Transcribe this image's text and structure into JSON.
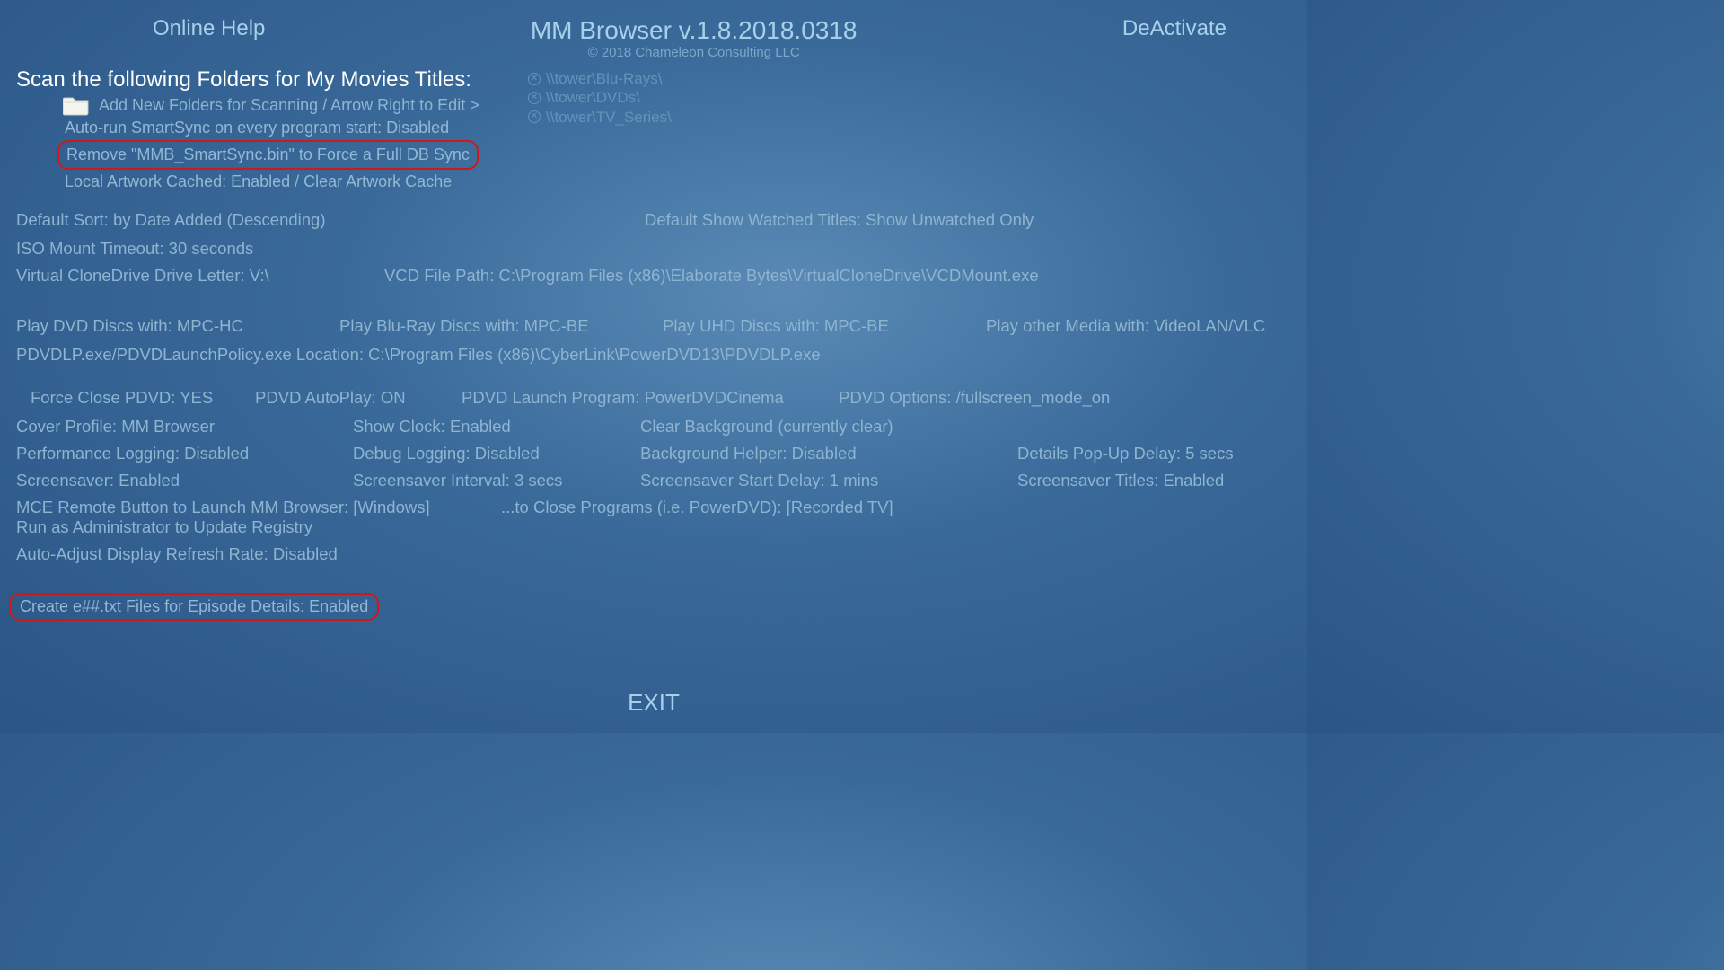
{
  "header": {
    "help": "Online Help",
    "title": "MM Browser v.1.8.2018.0318",
    "copyright": "© 2018 Chameleon Consulting LLC",
    "deactivate": "DeActivate"
  },
  "scan": {
    "heading": "Scan the following Folders for My Movies Titles:",
    "addFolders": "Add New Folders for Scanning / Arrow Right to Edit >",
    "paths": [
      "\\\\tower\\Blu-Rays\\",
      "\\\\tower\\DVDs\\",
      "\\\\tower\\TV_Series\\"
    ],
    "autorun": "Auto-run SmartSync on every program start:  Disabled",
    "remove": "Remove \"MMB_SmartSync.bin\" to Force a Full DB Sync",
    "artwork": "Local Artwork Cached: Enabled   / Clear Artwork Cache"
  },
  "settings": {
    "defaultSort": "Default Sort: by Date Added (Descending)",
    "defaultShow": "Default Show Watched Titles: Show Unwatched Only",
    "isoTimeout": "ISO Mount Timeout: 30 seconds",
    "vcdLetter": "Virtual CloneDrive Drive Letter:  V:\\",
    "vcdPath": "VCD File Path:  C:\\Program Files (x86)\\Elaborate Bytes\\VirtualCloneDrive\\VCDMount.exe",
    "playDVD": "Play DVD Discs with: MPC-HC",
    "playBlu": "Play Blu-Ray Discs with: MPC-BE",
    "playUHD": "Play UHD Discs with: MPC-BE",
    "playOther": "Play other Media with: VideoLAN/VLC",
    "pdvdlp": "PDVDLP.exe/PDVDLaunchPolicy.exe Location:  C:\\Program Files (x86)\\CyberLink\\PowerDVD13\\PDVDLP.exe",
    "forceClose": "Force Close PDVD: YES",
    "pdvdAuto": "PDVD AutoPlay: ON",
    "pdvdLaunch": "PDVD Launch Program: PowerDVDCinema",
    "pdvdOptions": "PDVD Options: /fullscreen_mode_on",
    "coverProfile": "Cover Profile: MM Browser",
    "showClock": "Show Clock: Enabled",
    "clearBg": "Clear Background (currently clear)",
    "perfLog": "Performance Logging:  Disabled",
    "debugLog": "Debug Logging:  Disabled",
    "bgHelper": "Background Helper:  Disabled",
    "popupDelay": "Details Pop-Up Delay: 5 secs",
    "screensaver": "Screensaver:  Enabled",
    "ssInterval": "Screensaver Interval: 3 secs",
    "ssDelay": "Screensaver Start Delay: 1 mins",
    "ssTitles": "Screensaver Titles:  Enabled",
    "mceLaunch": "MCE Remote Button to Launch MM Browser: [Windows]",
    "mceClose": "...to Close Programs (i.e. PowerDVD): [Recorded TV]",
    "runAdmin": "Run as Administrator to Update Registry",
    "autoRefresh": "Auto-Adjust Display Refresh Rate:  Disabled",
    "createTxt": "Create e##.txt Files for Episode Details:  Enabled"
  },
  "exit": "EXIT"
}
